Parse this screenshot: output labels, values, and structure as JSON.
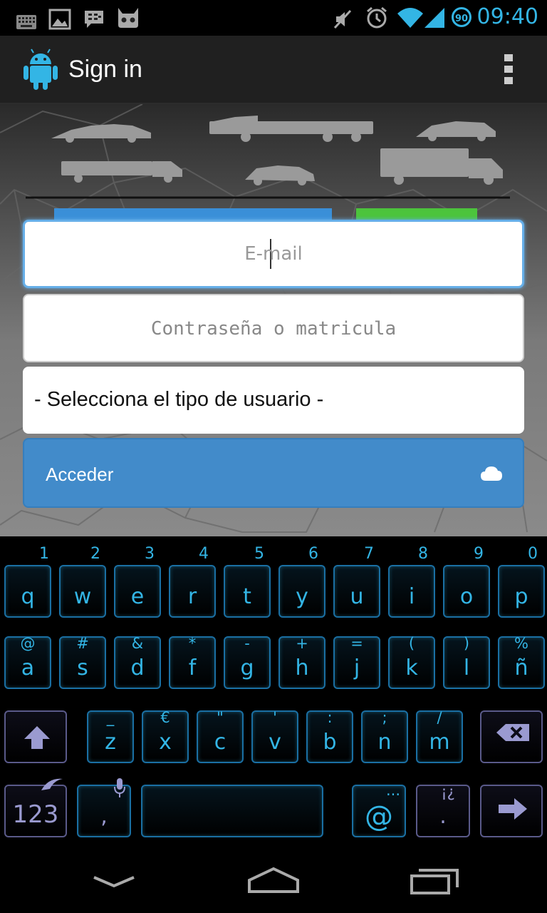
{
  "status_bar": {
    "time": "09:40",
    "battery": "90",
    "icons": [
      "keyboard-icon",
      "image-icon",
      "bbm-icon",
      "cyanogen-icon",
      "mute-icon",
      "alarm-icon",
      "wifi-icon",
      "signal-icon",
      "battery-icon"
    ]
  },
  "action_bar": {
    "title": "Sign in",
    "icons": [
      "android-logo-icon",
      "overflow-menu-icon"
    ]
  },
  "form": {
    "email_placeholder": "E-mail",
    "password_placeholder": "Contraseña o matricula",
    "usertype_selected": "- Selecciona el tipo de usuario -",
    "login_label": "Acceder",
    "login_icon": "cloud-icon"
  },
  "keyboard": {
    "digits": [
      "1",
      "2",
      "3",
      "4",
      "5",
      "6",
      "7",
      "8",
      "9",
      "0"
    ],
    "row1": [
      {
        "k": "q",
        "a": ""
      },
      {
        "k": "w",
        "a": ""
      },
      {
        "k": "e",
        "a": ""
      },
      {
        "k": "r",
        "a": ""
      },
      {
        "k": "t",
        "a": ""
      },
      {
        "k": "y",
        "a": ""
      },
      {
        "k": "u",
        "a": ""
      },
      {
        "k": "i",
        "a": ""
      },
      {
        "k": "o",
        "a": ""
      },
      {
        "k": "p",
        "a": ""
      }
    ],
    "row2": [
      {
        "k": "a",
        "a": "@"
      },
      {
        "k": "s",
        "a": "#"
      },
      {
        "k": "d",
        "a": "&"
      },
      {
        "k": "f",
        "a": "*"
      },
      {
        "k": "g",
        "a": "-"
      },
      {
        "k": "h",
        "a": "+"
      },
      {
        "k": "j",
        "a": "="
      },
      {
        "k": "k",
        "a": "("
      },
      {
        "k": "l",
        "a": ")"
      },
      {
        "k": "ñ",
        "a": "%"
      }
    ],
    "row3": [
      {
        "k": "z",
        "a": "_"
      },
      {
        "k": "x",
        "a": "€"
      },
      {
        "k": "c",
        "a": "\""
      },
      {
        "k": "v",
        "a": "'"
      },
      {
        "k": "b",
        "a": ":"
      },
      {
        "k": "n",
        "a": ";"
      },
      {
        "k": "m",
        "a": "/"
      }
    ],
    "row4": {
      "numbers_label": "123",
      "comma": ",",
      "at": "@",
      "at_alt": "...",
      "period": ".",
      "period_alt": "¡¿"
    }
  },
  "colors": {
    "accent": "#33b5e5",
    "button": "#428bca",
    "focus": "#66afe9"
  }
}
